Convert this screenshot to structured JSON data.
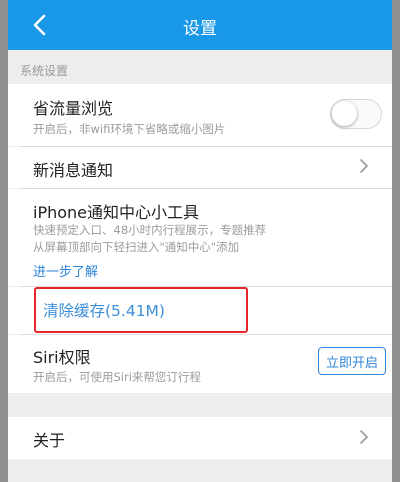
{
  "navbar": {
    "title": "设置",
    "back_icon": "chevron-left-icon"
  },
  "section": {
    "header": "系统设置"
  },
  "data_saver": {
    "title": "省流量浏览",
    "desc": "开启后，非wifi环境下省略或缩小图片",
    "toggle_on": false
  },
  "notifications": {
    "title": "新消息通知"
  },
  "widget": {
    "title": "iPhone通知中心小工具",
    "desc_line1": "快速预定入口、48小时内行程展示，专题推荐",
    "desc_line2": "从屏幕顶部向下轻扫进入\"通知中心\"添加",
    "link": "进一步了解"
  },
  "cache": {
    "label": "清除缓存(5.41M)"
  },
  "siri": {
    "title": "Siri权限",
    "desc": "开启后，可使用Siri来帮您订行程",
    "button": "立即开启"
  },
  "about": {
    "title": "关于"
  },
  "colors": {
    "accent": "#1a98e8",
    "link": "#2f86d8",
    "highlight": "#e8272b"
  }
}
